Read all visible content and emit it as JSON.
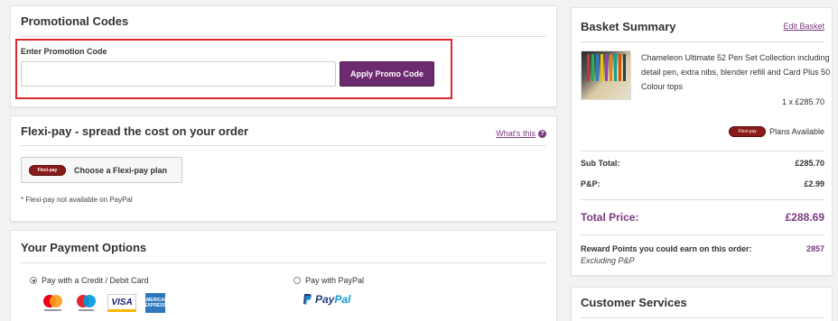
{
  "promo": {
    "title": "Promotional Codes",
    "label": "Enter Promotion Code",
    "input_value": "",
    "input_placeholder": "",
    "button": "Apply Promo Code"
  },
  "flexi": {
    "title": "Flexi-pay - spread the cost on your order",
    "whats_this": "What's this",
    "help_icon": "?",
    "badge": "Flexi-pay",
    "button": "Choose a Flexi-pay plan",
    "note": "* Flexi-pay not available on PayPal"
  },
  "payment": {
    "title": "Your Payment Options",
    "card_option": "Pay with a Credit / Debit Card",
    "paypal_option": "Pay with PayPal",
    "selected": "card",
    "card_icons": [
      "mastercard-icon",
      "maestro-icon",
      "visa-icon",
      "amex-icon"
    ],
    "visa_text": "VISA",
    "amex_text": "AMERICAN EXPRESS",
    "paypal_logo": {
      "pay": "Pay",
      "pal": "Pal"
    }
  },
  "basket": {
    "title": "Basket Summary",
    "edit": "Edit Basket",
    "product": {
      "name": "Chameleon Ultimate 52 Pen Set Collection including detail pen, extra nibs, blender refill and Card Plus 50 Colour tops",
      "qty_price": "1 x £285.70"
    },
    "flexi_badge": "Flexi-pay",
    "plans_available": "Plans Available",
    "subtotal_label": "Sub Total:",
    "subtotal_value": "£285.70",
    "pp_label": "P&P:",
    "pp_value": "£2.99",
    "total_label": "Total Price:",
    "total_value": "£288.69",
    "reward_label": "Reward Points you could earn on this order:",
    "reward_value": "2857",
    "reward_sub": "Excluding P&P"
  },
  "customer_services": {
    "title": "Customer Services"
  },
  "colors": {
    "accent": "#6c2b6f",
    "link": "#7a3a80",
    "highlight": "#e3262d",
    "flexi_badge": "#8b1a1a"
  }
}
